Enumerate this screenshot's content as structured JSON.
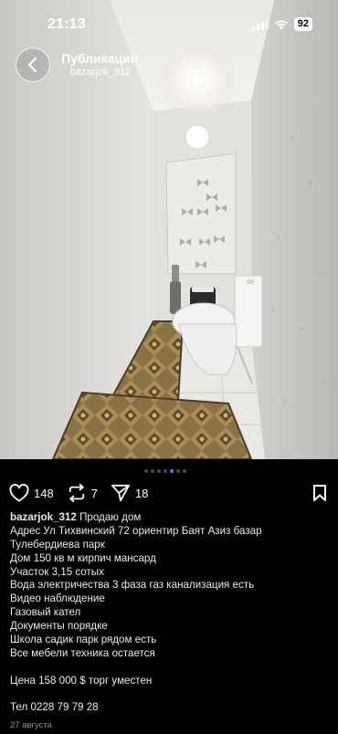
{
  "status_bar": {
    "time": "21:13",
    "battery": "92"
  },
  "header": {
    "title": "Публикации",
    "username": "bazarjok_312"
  },
  "carousel": {
    "total": 7,
    "active_index": 4
  },
  "actions": {
    "likes": "148",
    "reposts": "7",
    "shares": "18"
  },
  "caption": {
    "username": "bazarjok_312",
    "first_line": "Продаю дом",
    "lines": [
      "Адрес Ул Тихвинский 72 ориентир Баят Азиз базар",
      "Тулебердиева парк",
      "Дом 150 кв м кирпич мансард",
      "Участок 3,15 сотых",
      "Вода электричества 3 фаза газ канализация есть",
      "Видео наблюдение",
      "Газовый кател",
      "Документы порядке",
      "Школа садик парк рядом есть",
      "Все мебели техника остается"
    ],
    "price_line": "Цена 158 000 $ торг уместен",
    "phone_line": "Тел 0228 79 79 28"
  },
  "date": "27 августа",
  "colors": {
    "background": "#000000",
    "accent_dot": "#3b82f6",
    "secondary_text": "#8e8e8e"
  }
}
